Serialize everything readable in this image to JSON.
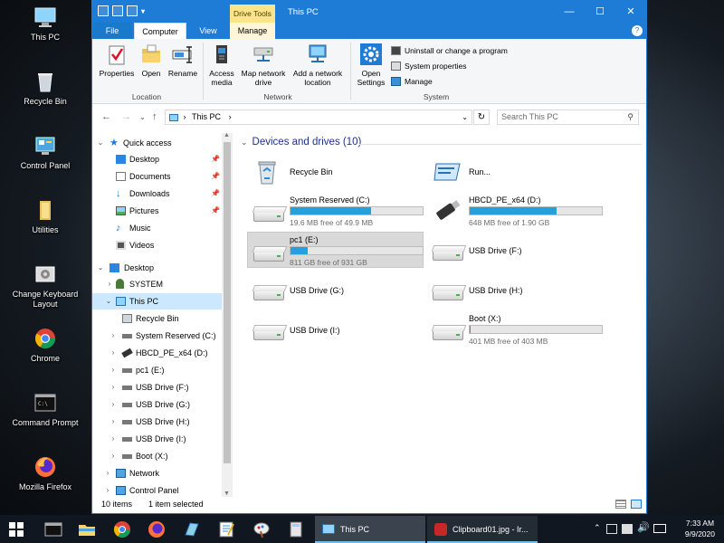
{
  "desktop": {
    "icons": [
      {
        "label": "This PC"
      },
      {
        "label": "Recycle Bin"
      },
      {
        "label": "Control Panel"
      },
      {
        "label": "Utilities"
      },
      {
        "label": "Change Keyboard Layout"
      },
      {
        "label": "Chrome"
      },
      {
        "label": "Command Prompt"
      },
      {
        "label": "Mozilla Firefox"
      }
    ]
  },
  "window": {
    "title": "This PC",
    "contextual_tab": "Drive Tools",
    "controls": {
      "minimize": "—",
      "maximize": "☐",
      "close": "✕"
    }
  },
  "ribbon": {
    "tabs": {
      "file": "File",
      "computer": "Computer",
      "view": "View",
      "manage": "Manage"
    },
    "location": {
      "properties": "Properties",
      "open": "Open",
      "rename": "Rename",
      "group": "Location"
    },
    "network": {
      "access_media": "Access media",
      "map_network_drive": "Map network drive",
      "add_network_location": "Add a network location",
      "group": "Network"
    },
    "system": {
      "open_settings": "Open Settings",
      "uninstall": "Uninstall or change a program",
      "system_properties": "System properties",
      "manage": "Manage",
      "group": "System"
    },
    "help": "?"
  },
  "address": {
    "path": "This PC",
    "search_placeholder": "Search This PC"
  },
  "nav": {
    "items": [
      {
        "label": "Quick access"
      },
      {
        "label": "Desktop"
      },
      {
        "label": "Documents"
      },
      {
        "label": "Downloads"
      },
      {
        "label": "Pictures"
      },
      {
        "label": "Music"
      },
      {
        "label": "Videos"
      },
      {
        "label": "Desktop"
      },
      {
        "label": "SYSTEM"
      },
      {
        "label": "This PC"
      },
      {
        "label": "Recycle Bin"
      },
      {
        "label": "System Reserved (C:)"
      },
      {
        "label": "HBCD_PE_x64 (D:)"
      },
      {
        "label": "pc1 (E:)"
      },
      {
        "label": "USB Drive (F:)"
      },
      {
        "label": "USB Drive (G:)"
      },
      {
        "label": "USB Drive (H:)"
      },
      {
        "label": "USB Drive (I:)"
      },
      {
        "label": "Boot (X:)"
      },
      {
        "label": "Network"
      },
      {
        "label": "Control Panel"
      }
    ]
  },
  "content": {
    "header": "Devices and drives (10)",
    "drives": [
      {
        "name": "Recycle Bin"
      },
      {
        "name": "Run..."
      },
      {
        "name": "System Reserved (C:)",
        "used": 0.61,
        "free": "19.6 MB free of 49.9 MB"
      },
      {
        "name": "HBCD_PE_x64 (D:)",
        "used": 0.66,
        "free": "648 MB free of 1.90 GB"
      },
      {
        "name": "pc1 (E:)",
        "used": 0.13,
        "free": "811 GB free of 931 GB"
      },
      {
        "name": "USB Drive (F:)"
      },
      {
        "name": "USB Drive (G:)"
      },
      {
        "name": "USB Drive (H:)"
      },
      {
        "name": "USB Drive (I:)"
      },
      {
        "name": "Boot (X:)",
        "used": 0.005,
        "free": "401 MB free of 403 MB"
      }
    ]
  },
  "status": {
    "count": "10 items",
    "selected": "1 item selected"
  },
  "taskbar": {
    "tasks": [
      {
        "label": "This PC"
      },
      {
        "label": "Clipboard01.jpg - Ir..."
      }
    ],
    "time": "7:33 AM",
    "date": "9/9/2020"
  }
}
